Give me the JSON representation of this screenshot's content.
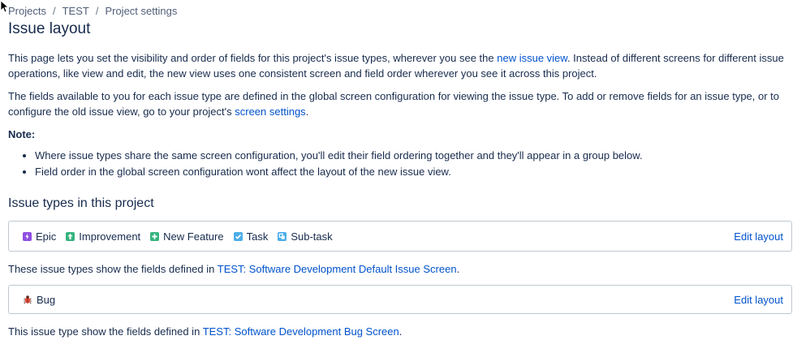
{
  "breadcrumb": {
    "items": [
      "Projects",
      "TEST",
      "Project settings"
    ],
    "separator": "/"
  },
  "page_title": "Issue layout",
  "intro": {
    "p1_before": "This page lets you set the visibility and order of fields for this project's issue types, wherever you see the ",
    "p1_link": "new issue view",
    "p1_after": ". Instead of different screens for different issue operations, like view and edit, the new view uses one consistent screen and field order wherever you see it across this project.",
    "p2_before": "The fields available to you for each issue type are defined in the global screen configuration for viewing the issue type. To add or remove fields for an issue type, or to configure the old issue view, go to your project's ",
    "p2_link": "screen settings",
    "p2_after": "."
  },
  "note": {
    "label": "Note:",
    "items": [
      "Where issue types share the same screen configuration, you'll edit their field ordering together and they'll appear in a group below.",
      "Field order in the global screen configuration wont affect the layout of the new issue view."
    ]
  },
  "section_title": "Issue types in this project",
  "groups": [
    {
      "types": [
        {
          "label": "Epic",
          "icon": "epic-icon",
          "color": "#904ee2"
        },
        {
          "label": "Improvement",
          "icon": "improvement-icon",
          "color": "#36b37e"
        },
        {
          "label": "New Feature",
          "icon": "new-feature-icon",
          "color": "#36b37e"
        },
        {
          "label": "Task",
          "icon": "task-icon",
          "color": "#4bade8"
        },
        {
          "label": "Sub-task",
          "icon": "subtask-icon",
          "color": "#4bade8"
        }
      ],
      "edit_label": "Edit layout",
      "desc_before": "These issue types show the fields defined in ",
      "desc_link": "TEST: Software Development Default Issue Screen",
      "desc_after": "."
    },
    {
      "types": [
        {
          "label": "Bug",
          "icon": "bug-icon",
          "color": "#e5493a"
        }
      ],
      "edit_label": "Edit layout",
      "desc_before": "This issue type show the fields defined in ",
      "desc_link": "TEST: Software Development Bug Screen",
      "desc_after": "."
    }
  ],
  "colors": {
    "text": "#172b4d",
    "link": "#0052cc",
    "border": "#c1c7d0"
  }
}
